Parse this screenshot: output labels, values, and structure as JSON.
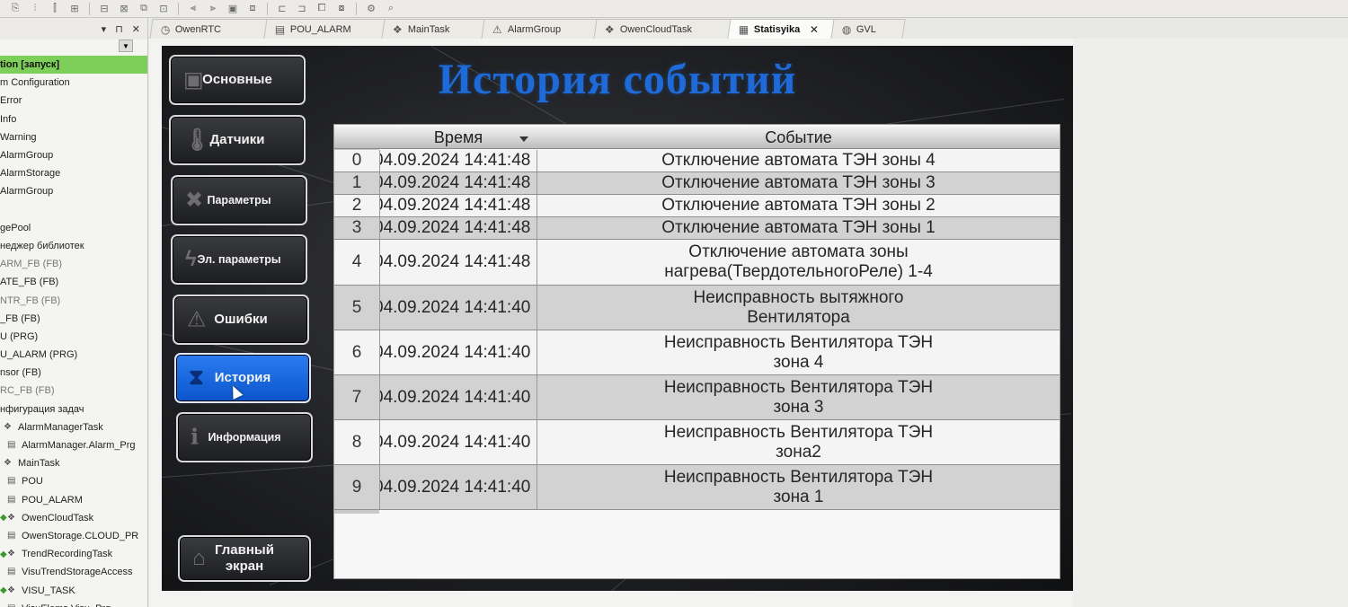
{
  "toolbar": {
    "icons": [
      "step-into-icon",
      "step-over-icon",
      "step-out-icon",
      "breakpoint-icon",
      "run-icon",
      "stop-icon",
      "login-icon",
      "logout-icon",
      "toggle-icon",
      "grid-icon",
      "window-icon",
      "layout-icon",
      "panel-icon",
      "split-icon",
      "tile-icon",
      "cascade-icon",
      "lock-icon",
      "zoom-icon"
    ]
  },
  "tree": {
    "header_pin": " ▾   ⊓   ✕",
    "items": [
      {
        "label": "tion [запуск]",
        "active": true
      },
      {
        "label": "m Configuration"
      },
      {
        "label": "Error"
      },
      {
        "label": "Info"
      },
      {
        "label": "Warning"
      },
      {
        "label": "AlarmGroup"
      },
      {
        "label": "AlarmStorage"
      },
      {
        "label": "AlarmGroup"
      },
      {
        "label": ""
      },
      {
        "label": "gePool"
      },
      {
        "label": "неджер библиотек"
      },
      {
        "label": "ARM_FB (FB)",
        "dim": true
      },
      {
        "label": "ATE_FB (FB)"
      },
      {
        "label": "NTR_FB (FB)",
        "dim": true
      },
      {
        "label": "_FB (FB)"
      },
      {
        "label": "U (PRG)"
      },
      {
        "label": "U_ALARM (PRG)"
      },
      {
        "label": "nsor (FB)"
      },
      {
        "label": "RC_FB (FB)",
        "dim": true
      },
      {
        "label": "нфигурация задач"
      },
      {
        "label": "AlarmManagerTask",
        "icon": true
      },
      {
        "label": "AlarmManager.Alarm_Prg",
        "icon": true,
        "indent": true
      },
      {
        "label": "MainTask",
        "icon": true
      },
      {
        "label": "POU",
        "icon": true,
        "indent": true
      },
      {
        "label": "POU_ALARM",
        "icon": true,
        "indent": true
      },
      {
        "label": "OwenCloudTask",
        "icon": true,
        "plus": true
      },
      {
        "label": "OwenStorage.CLOUD_PR",
        "icon": true,
        "indent": true
      },
      {
        "label": "TrendRecordingTask",
        "icon": true,
        "plus": true
      },
      {
        "label": "VisuTrendStorageAccess",
        "icon": true,
        "indent": true
      },
      {
        "label": "VISU_TASK",
        "icon": true,
        "plus": true
      },
      {
        "label": "VisuElems.Visu_Prg",
        "icon": true,
        "indent": true
      }
    ]
  },
  "tabs": [
    {
      "label": "OwenRTC",
      "icon": "◷"
    },
    {
      "label": "POU_ALARM",
      "icon": "▤"
    },
    {
      "label": "MainTask",
      "icon": "❖"
    },
    {
      "label": "AlarmGroup",
      "icon": "⚠"
    },
    {
      "label": "OwenCloudTask",
      "icon": "❖"
    },
    {
      "label": "Statisyika",
      "icon": "▦",
      "active": true
    },
    {
      "label": "GVL",
      "icon": "◍"
    }
  ],
  "visu": {
    "title": "История событий",
    "nav": [
      {
        "label": "Основные",
        "icon": "▣",
        "name": "nav-button-main"
      },
      {
        "label": "Датчики",
        "icon": "🌡",
        "name": "nav-button-sensors"
      },
      {
        "label": "Параметры",
        "icon": "✖",
        "name": "nav-button-parameters",
        "small": true
      },
      {
        "label": "Эл. параметры",
        "icon": "ϟ",
        "name": "nav-button-electrical-parameters",
        "small": true
      },
      {
        "label": "Ошибки",
        "icon": "⚠",
        "name": "nav-button-errors"
      },
      {
        "label": "История",
        "icon": "⧗",
        "name": "nav-button-history",
        "active": true
      },
      {
        "label": "Информация",
        "icon": "ℹ",
        "name": "nav-button-information",
        "small": true
      },
      {
        "label": "Главный экран",
        "icon": "⌂",
        "name": "nav-button-main-screen"
      }
    ],
    "table": {
      "columns": [
        "Время",
        "Событие"
      ],
      "rows": [
        {
          "idx": "0",
          "time": "04.09.2024 14:41:48",
          "event": "Отключение автомата ТЭН зоны 4"
        },
        {
          "idx": "1",
          "time": "04.09.2024 14:41:48",
          "event": "Отключение автомата ТЭН зоны 3"
        },
        {
          "idx": "2",
          "time": "04.09.2024 14:41:48",
          "event": "Отключение автомата ТЭН зоны 2"
        },
        {
          "idx": "3",
          "time": "04.09.2024 14:41:48",
          "event": "Отключение автомата ТЭН зоны 1"
        },
        {
          "idx": "4",
          "time": "04.09.2024 14:41:48",
          "event": "Отключение автомата зоны нагрева(ТвердотельногоРеле) 1-4"
        },
        {
          "idx": "5",
          "time": "04.09.2024 14:41:40",
          "event": "Неисправность вытяжного Вентилятора"
        },
        {
          "idx": "6",
          "time": "04.09.2024 14:41:40",
          "event": "Неисправность Вентилятора ТЭН зона 4"
        },
        {
          "idx": "7",
          "time": "04.09.2024 14:41:40",
          "event": "Неисправность Вентилятора ТЭН зона 3"
        },
        {
          "idx": "8",
          "time": "04.09.2024 14:41:40",
          "event": "Неисправность Вентилятора ТЭН зона2"
        },
        {
          "idx": "9",
          "time": "04.09.2024 14:41:40",
          "event": "Неисправность Вентилятора ТЭН зона 1"
        }
      ]
    }
  }
}
